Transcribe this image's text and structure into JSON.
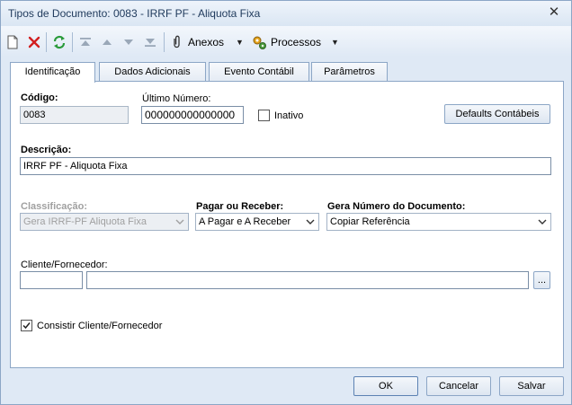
{
  "window": {
    "title": "Tipos de Documento: 0083 - IRRF PF - Aliquota Fixa",
    "close_symbol": "✕"
  },
  "toolbar": {
    "anexos_label": "Anexos",
    "processos_label": "Processos",
    "icons": [
      "new-document-icon",
      "delete-icon",
      "refresh-icon",
      "first-record-icon",
      "previous-record-icon",
      "next-record-icon",
      "last-record-icon",
      "paperclip-icon",
      "processes-gear-icon"
    ]
  },
  "tabs": [
    {
      "label": "Identificação"
    },
    {
      "label": "Dados Adicionais"
    },
    {
      "label": "Evento Contábil"
    },
    {
      "label": "Parâmetros"
    }
  ],
  "form": {
    "codigo_label": "Código:",
    "codigo_value": "0083",
    "ultimo_numero_label": "Último Número:",
    "ultimo_numero_value": "000000000000000",
    "inativo_label": "Inativo",
    "defaults_button": "Defaults Contábeis",
    "descricao_label": "Descrição:",
    "descricao_value": "IRRF PF - Aliquota Fixa",
    "classificacao_label": "Classificação:",
    "classificacao_value": "Gera IRRF-PF Aliquota Fixa",
    "pagar_receber_label": "Pagar ou Receber:",
    "pagar_receber_value": "A Pagar e A Receber",
    "gera_numero_label": "Gera Número do Documento:",
    "gera_numero_value": "Copiar Referência",
    "cliente_label": "Cliente/Fornecedor:",
    "cliente_code": "",
    "cliente_name": "",
    "lookup_button": "...",
    "consistir_label": "Consistir Cliente/Fornecedor",
    "consistir_checked": true
  },
  "footer": {
    "ok": "OK",
    "cancel": "Cancelar",
    "save": "Salvar"
  },
  "colors": {
    "window_bg": "#dfe9f5",
    "border": "#8ca6c6",
    "delete_red": "#d21f1f",
    "refresh_green": "#2a9b3a"
  }
}
